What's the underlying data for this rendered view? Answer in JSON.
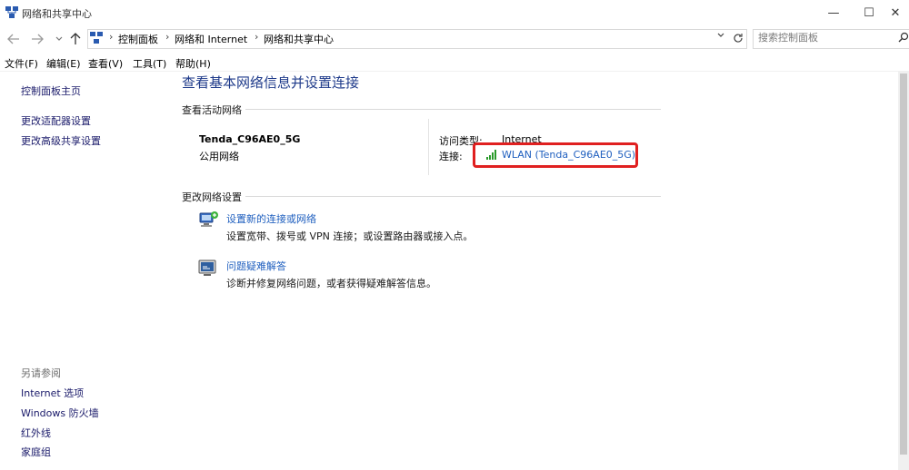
{
  "window": {
    "title": "网络和共享中心",
    "controls": {
      "minimize": "—",
      "maximize": "☐",
      "close": "✕"
    }
  },
  "nav": {
    "back_icon": "arrow-left-icon",
    "forward_icon": "arrow-right-icon",
    "recent_icon": "chevron-down-icon",
    "up_icon": "arrow-up-icon",
    "breadcrumbs": [
      "控制面板",
      "网络和 Internet",
      "网络和共享中心"
    ],
    "search_placeholder": "搜索控制面板"
  },
  "menu": [
    "文件(F)",
    "编辑(E)",
    "查看(V)",
    "工具(T)",
    "帮助(H)"
  ],
  "sidebar": {
    "links": [
      "控制面板主页",
      "更改适配器设置",
      "更改高级共享设置"
    ],
    "see_also_heading": "另请参阅",
    "see_also": [
      "Internet 选项",
      "Windows 防火墙",
      "红外线",
      "家庭组"
    ]
  },
  "main": {
    "title": "查看基本网络信息并设置连接",
    "active_section": "查看活动网络",
    "network": {
      "name": "Tenda_C96AE0_5G",
      "category": "公用网络",
      "access_type_label": "访问类型:",
      "access_type_value": "Internet",
      "connection_label": "连接:",
      "connection_value": "WLAN (Tenda_C96AE0_5G)"
    },
    "change_section": "更改网络设置",
    "tasks": [
      {
        "link": "设置新的连接或网络",
        "desc": "设置宽带、拨号或 VPN 连接；或设置路由器或接入点。",
        "icon": "new-connection-icon"
      },
      {
        "link": "问题疑难解答",
        "desc": "诊断并修复网络问题，或者获得疑难解答信息。",
        "icon": "troubleshoot-icon"
      }
    ]
  },
  "colors": {
    "highlight_box": "#e02020",
    "link": "#1f5fbf",
    "title": "#1e3a8a"
  }
}
